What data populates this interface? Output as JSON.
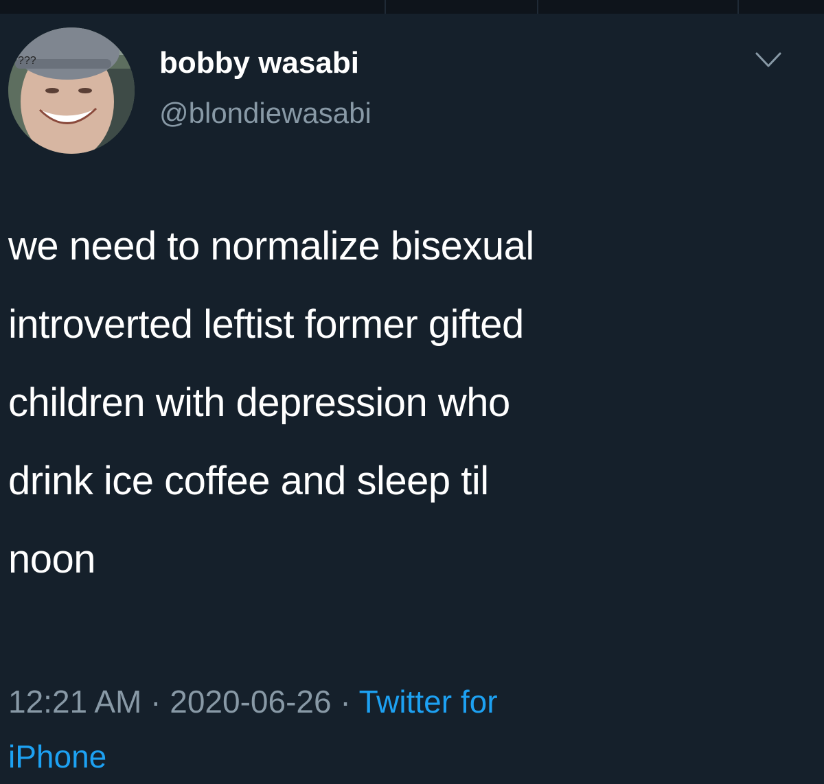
{
  "tweet": {
    "display_name": "bobby wasabi",
    "handle": "@blondiewasabi",
    "avatar_overlay_text": "???",
    "text_lines": [
      "we need to normalize bisexual",
      "introverted leftist former gifted",
      "children with depression who",
      "drink ice coffee and sleep til",
      "noon"
    ],
    "time": "12:21 AM",
    "separator": " · ",
    "date": "2020-06-26",
    "source_line1": "Twitter for",
    "source_line2": "iPhone"
  },
  "icons": {
    "caret": "chevron-down-icon"
  },
  "colors": {
    "background": "#15202b",
    "primary_text": "#ffffff",
    "secondary_text": "#8899a6",
    "link": "#1da1f2"
  }
}
